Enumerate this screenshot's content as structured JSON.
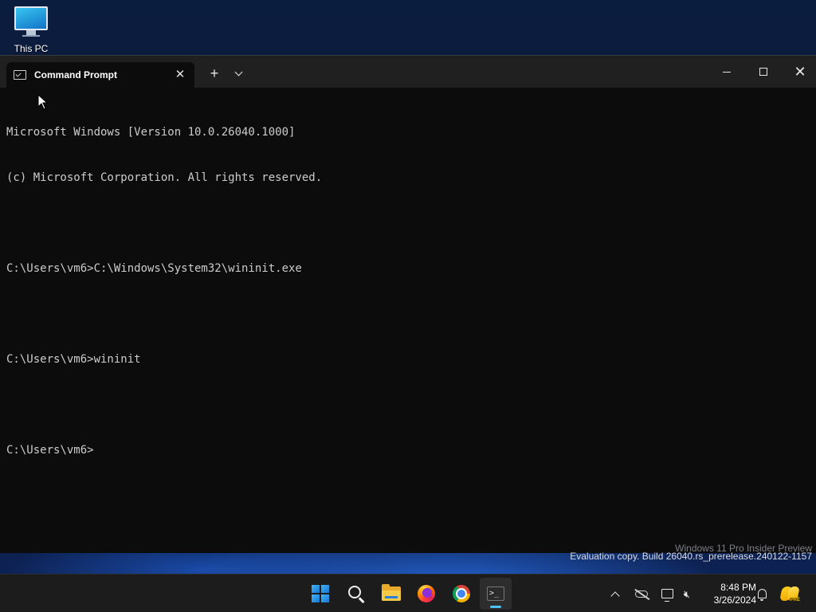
{
  "desktop": {
    "icons": [
      {
        "label": "This PC",
        "icon": "monitor-icon"
      }
    ]
  },
  "window": {
    "tab": {
      "title": "Command Prompt",
      "icon": "cmd-icon",
      "close_symbol": "✕"
    },
    "new_tab_symbol": "+",
    "dropdown_icon": "chevron-down-icon",
    "controls": {
      "minimize": "minimize-icon",
      "maximize": "maximize-icon",
      "close": "close-icon",
      "close_symbol": "✕"
    }
  },
  "console": {
    "lines": [
      "Microsoft Windows [Version 10.0.26040.1000]",
      "(c) Microsoft Corporation. All rights reserved.",
      "",
      "C:\\Users\\vm6>C:\\Windows\\System32\\wininit.exe",
      "",
      "C:\\Users\\vm6>wininit",
      "",
      "C:\\Users\\vm6>"
    ],
    "text_color": "#cccccc",
    "background": "#0c0c0c"
  },
  "watermark": {
    "line1": "Windows 11 Pro Insider Preview",
    "line2": "Evaluation copy. Build 26040.rs_prerelease.240122-1157"
  },
  "taskbar": {
    "apps": [
      {
        "name": "start",
        "icon": "windows-logo-icon",
        "active": false
      },
      {
        "name": "search",
        "icon": "search-icon",
        "active": false
      },
      {
        "name": "file-explorer",
        "icon": "folder-icon",
        "active": false
      },
      {
        "name": "firefox",
        "icon": "firefox-icon",
        "active": false
      },
      {
        "name": "chrome",
        "icon": "chrome-icon",
        "active": false
      },
      {
        "name": "terminal",
        "icon": "terminal-icon",
        "active": true
      }
    ],
    "terminal_glyph": ">_",
    "tray": {
      "icons": [
        "chevron-up-icon",
        "onedrive-off-icon",
        "network-icon",
        "volume-muted-icon"
      ],
      "time": "8:48 PM",
      "date": "3/26/2024",
      "notification_icon": "bell-icon",
      "copilot_badge": "PRE"
    }
  },
  "colors": {
    "accent": "#4cc2ff",
    "titlebar": "#202020",
    "taskbar": "#1c1c1c"
  }
}
